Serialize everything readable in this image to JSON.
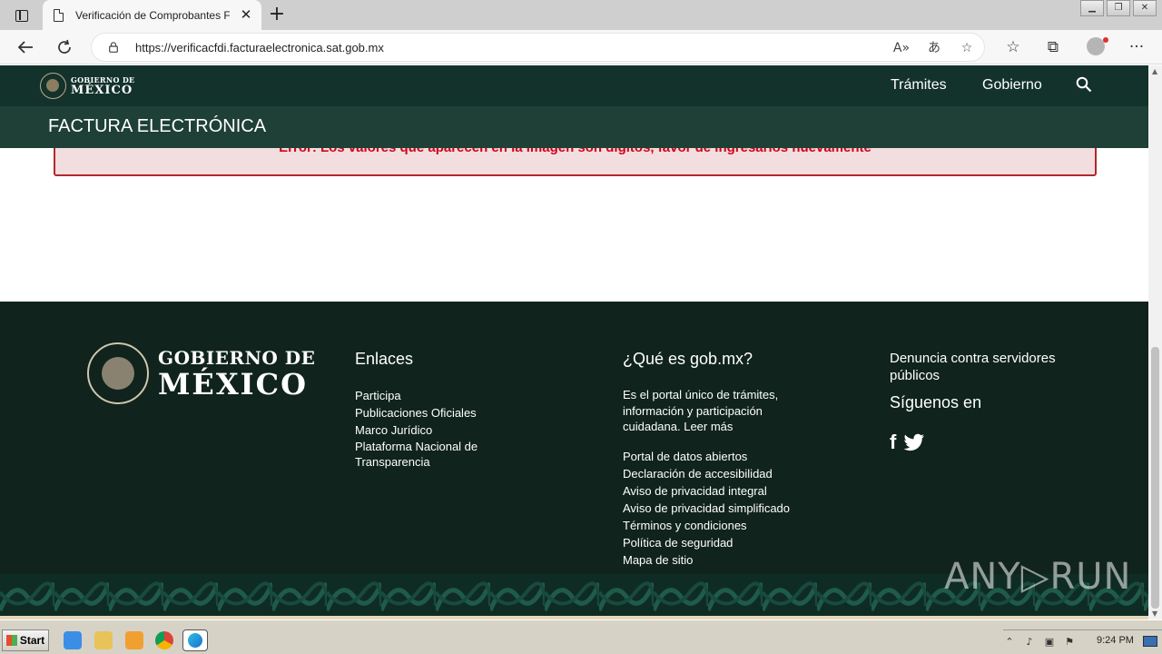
{
  "browser": {
    "tab_title": "Verificación de Comprobantes Fi",
    "tab_close": "✕",
    "new_tab": "+",
    "url": "https://verificacfdi.facturaelectronica.sat.gob.mx"
  },
  "header": {
    "logo_line1": "GOBIERNO DE",
    "logo_line2": "MÉXICO",
    "nav": [
      "Trámites",
      "Gobierno"
    ],
    "subtitle": "FACTURA ELECTRÓNICA"
  },
  "alert": {
    "text": "Error: Los valores que aparecen en la imagen son dígitos, favor de ingresarlos nuevamente"
  },
  "footer": {
    "logo_line1": "GOBIERNO DE",
    "logo_line2": "MÉXICO",
    "enlaces": {
      "title": "Enlaces",
      "items": [
        "Participa",
        "Publicaciones Oficiales",
        "Marco Jurídico",
        "Plataforma Nacional de Transparencia"
      ]
    },
    "que_es": {
      "title": "¿Qué es gob.mx?",
      "description": "Es el portal único de trámites, información y participación cuidadana. Leer más",
      "items": [
        "Portal de datos abiertos",
        "Declaración de accesibilidad",
        "Aviso de privacidad integral",
        "Aviso de privacidad simplificado",
        "Términos y condiciones",
        "Política de seguridad",
        "Mapa de sitio"
      ]
    },
    "denuncia": "Denuncia contra servidores públicos",
    "siguenos": "Síguenos en",
    "social_icons": [
      "facebook-icon",
      "twitter-icon"
    ]
  },
  "watermark": "ANY▷RUN",
  "taskbar": {
    "start": "Start",
    "clock": "9:24 PM"
  },
  "colors": {
    "header": "#13322b",
    "subheader": "#1e4037",
    "footer": "#10231d",
    "error_text": "#d0021b",
    "error_bg": "#f2dede"
  }
}
